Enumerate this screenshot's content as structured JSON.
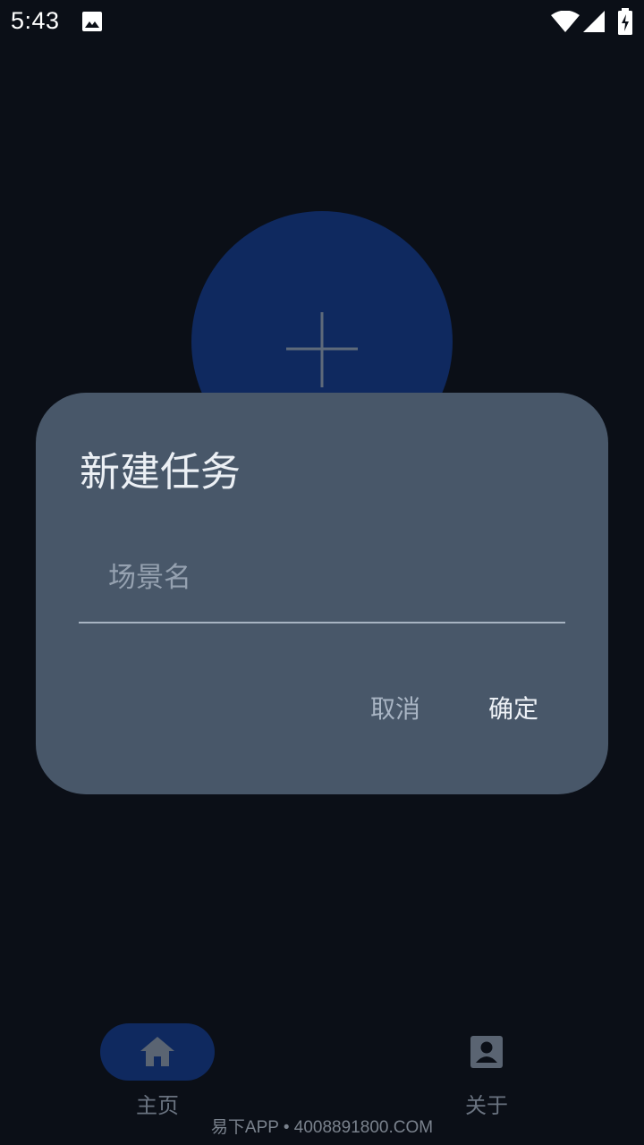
{
  "status_bar": {
    "time": "5:43",
    "icons": [
      "image-icon",
      "wifi-icon",
      "signal-icon",
      "battery-charging-icon"
    ]
  },
  "fab": {
    "icon": "plus-icon",
    "color": "#0f295f"
  },
  "dialog": {
    "title": "新建任务",
    "input": {
      "value": "",
      "placeholder": "场景名"
    },
    "cancel_label": "取消",
    "confirm_label": "确定",
    "background": "#485769"
  },
  "bottom_nav": {
    "items": [
      {
        "label": "主页",
        "icon": "home-icon",
        "selected": true
      },
      {
        "label": "关于",
        "icon": "account-box-icon",
        "selected": false
      }
    ]
  },
  "watermark": "易下APP • 4008891800.COM"
}
